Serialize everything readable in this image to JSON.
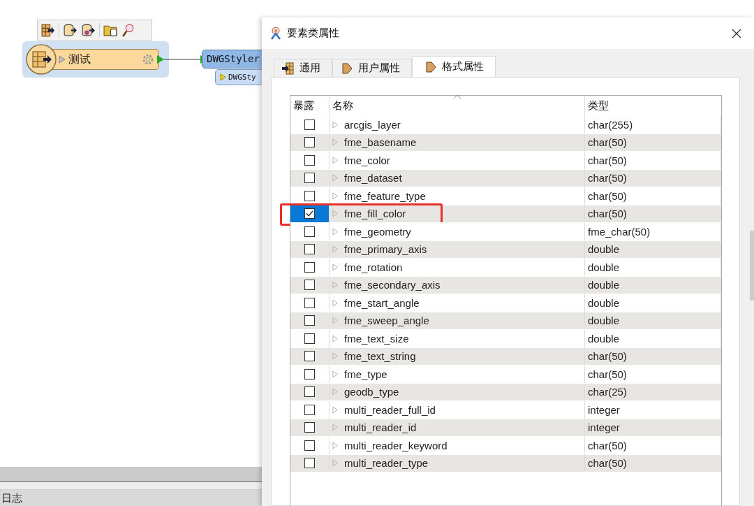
{
  "canvas": {
    "source_node": {
      "label": "测试"
    },
    "target_node": {
      "label": "DWGStyler",
      "port": "DWGSty"
    }
  },
  "log_panel": {
    "tab": "日志"
  },
  "dialog": {
    "title": "要素类属性",
    "tabs": [
      {
        "label": "通用",
        "selected": false
      },
      {
        "label": "用户属性",
        "selected": false
      },
      {
        "label": "格式属性",
        "selected": true
      }
    ],
    "table": {
      "columns": [
        "暴露",
        "名称",
        "类型"
      ],
      "rows": [
        {
          "checked": false,
          "selected": false,
          "highlighted": false,
          "name": "arcgis_layer",
          "type": "char(255)"
        },
        {
          "checked": false,
          "selected": false,
          "highlighted": false,
          "name": "fme_basename",
          "type": "char(50)"
        },
        {
          "checked": false,
          "selected": false,
          "highlighted": false,
          "name": "fme_color",
          "type": "char(50)"
        },
        {
          "checked": false,
          "selected": false,
          "highlighted": false,
          "name": "fme_dataset",
          "type": "char(50)"
        },
        {
          "checked": false,
          "selected": false,
          "highlighted": false,
          "name": "fme_feature_type",
          "type": "char(50)"
        },
        {
          "checked": true,
          "selected": true,
          "highlighted": true,
          "name": "fme_fill_color",
          "type": "char(50)"
        },
        {
          "checked": false,
          "selected": false,
          "highlighted": false,
          "name": "fme_geometry",
          "type": "fme_char(50)"
        },
        {
          "checked": false,
          "selected": false,
          "highlighted": false,
          "name": "fme_primary_axis",
          "type": "double"
        },
        {
          "checked": false,
          "selected": false,
          "highlighted": false,
          "name": "fme_rotation",
          "type": "double"
        },
        {
          "checked": false,
          "selected": false,
          "highlighted": false,
          "name": "fme_secondary_axis",
          "type": "double"
        },
        {
          "checked": false,
          "selected": false,
          "highlighted": false,
          "name": "fme_start_angle",
          "type": "double"
        },
        {
          "checked": false,
          "selected": false,
          "highlighted": false,
          "name": "fme_sweep_angle",
          "type": "double"
        },
        {
          "checked": false,
          "selected": false,
          "highlighted": false,
          "name": "fme_text_size",
          "type": "double"
        },
        {
          "checked": false,
          "selected": false,
          "highlighted": false,
          "name": "fme_text_string",
          "type": "char(50)"
        },
        {
          "checked": false,
          "selected": false,
          "highlighted": false,
          "name": "fme_type",
          "type": "char(50)"
        },
        {
          "checked": false,
          "selected": false,
          "highlighted": false,
          "name": "geodb_type",
          "type": "char(25)"
        },
        {
          "checked": false,
          "selected": false,
          "highlighted": false,
          "name": "multi_reader_full_id",
          "type": "integer"
        },
        {
          "checked": false,
          "selected": false,
          "highlighted": false,
          "name": "multi_reader_id",
          "type": "integer"
        },
        {
          "checked": false,
          "selected": false,
          "highlighted": false,
          "name": "multi_reader_keyword",
          "type": "char(50)"
        },
        {
          "checked": false,
          "selected": false,
          "highlighted": false,
          "name": "multi_reader_type",
          "type": "char(50)"
        }
      ]
    }
  }
}
